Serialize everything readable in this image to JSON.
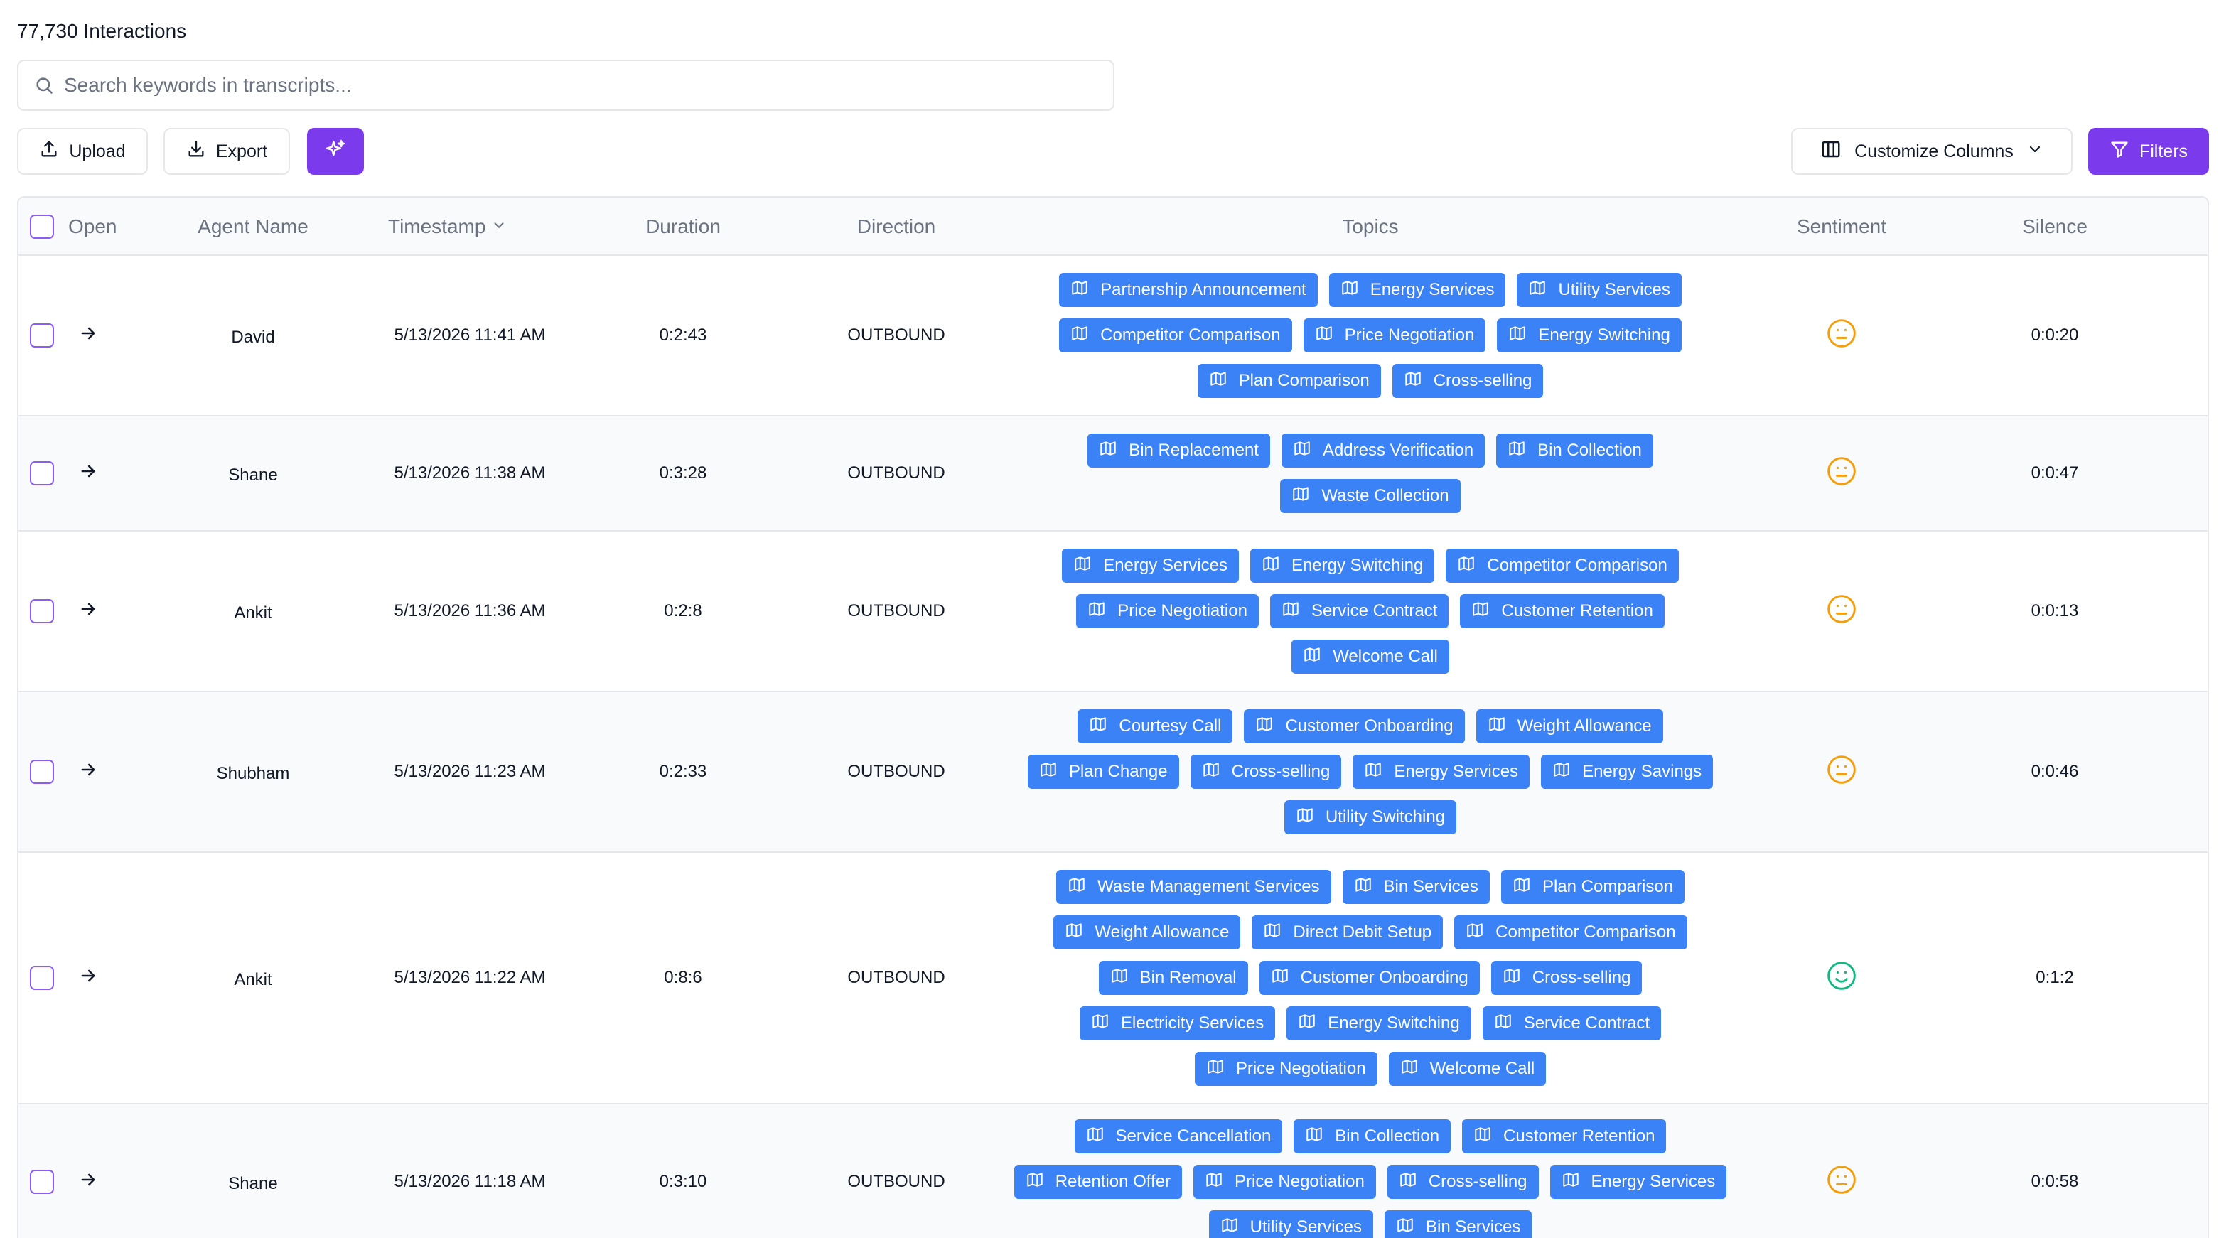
{
  "header": {
    "count_label": "77,730 Interactions"
  },
  "search": {
    "placeholder": "Search keywords in transcripts..."
  },
  "toolbar": {
    "upload_label": "Upload",
    "export_label": "Export",
    "customize_label": "Customize Columns",
    "filters_label": "Filters"
  },
  "colors": {
    "accent": "#7c3aed",
    "tag": "#3b82f6",
    "neutral_sentiment": "#f59e0b",
    "positive_sentiment": "#10b981"
  },
  "table": {
    "columns": {
      "open": "Open",
      "agent": "Agent Name",
      "timestamp": "Timestamp",
      "duration": "Duration",
      "direction": "Direction",
      "topics": "Topics",
      "sentiment": "Sentiment",
      "silence": "Silence"
    },
    "rows": [
      {
        "agent": "David",
        "timestamp": "5/13/2026 11:41 AM",
        "duration": "0:2:43",
        "direction": "OUTBOUND",
        "sentiment": "neutral",
        "silence": "0:0:20",
        "topics": [
          "Partnership Announcement",
          "Energy Services",
          "Utility Services",
          "Competitor Comparison",
          "Price Negotiation",
          "Energy Switching",
          "Plan Comparison",
          "Cross-selling"
        ]
      },
      {
        "agent": "Shane",
        "timestamp": "5/13/2026 11:38 AM",
        "duration": "0:3:28",
        "direction": "OUTBOUND",
        "sentiment": "neutral",
        "silence": "0:0:47",
        "topics": [
          "Bin Replacement",
          "Address Verification",
          "Bin Collection",
          "Waste Collection"
        ]
      },
      {
        "agent": "Ankit",
        "timestamp": "5/13/2026 11:36 AM",
        "duration": "0:2:8",
        "direction": "OUTBOUND",
        "sentiment": "neutral",
        "silence": "0:0:13",
        "topics": [
          "Energy Services",
          "Energy Switching",
          "Competitor Comparison",
          "Price Negotiation",
          "Service Contract",
          "Customer Retention",
          "Welcome Call"
        ]
      },
      {
        "agent": "Shubham",
        "timestamp": "5/13/2026 11:23 AM",
        "duration": "0:2:33",
        "direction": "OUTBOUND",
        "sentiment": "neutral",
        "silence": "0:0:46",
        "topics": [
          "Courtesy Call",
          "Customer Onboarding",
          "Weight Allowance",
          "Plan Change",
          "Cross-selling",
          "Energy Services",
          "Energy Savings",
          "Utility Switching"
        ]
      },
      {
        "agent": "Ankit",
        "timestamp": "5/13/2026 11:22 AM",
        "duration": "0:8:6",
        "direction": "OUTBOUND",
        "sentiment": "positive",
        "silence": "0:1:2",
        "topics": [
          "Waste Management Services",
          "Bin Services",
          "Plan Comparison",
          "Weight Allowance",
          "Direct Debit Setup",
          "Competitor Comparison",
          "Bin Removal",
          "Customer Onboarding",
          "Cross-selling",
          "Electricity Services",
          "Energy Switching",
          "Service Contract",
          "Price Negotiation",
          "Welcome Call"
        ]
      },
      {
        "agent": "Shane",
        "timestamp": "5/13/2026 11:18 AM",
        "duration": "0:3:10",
        "direction": "OUTBOUND",
        "sentiment": "neutral",
        "silence": "0:0:58",
        "topics": [
          "Service Cancellation",
          "Bin Collection",
          "Customer Retention",
          "Retention Offer",
          "Price Negotiation",
          "Cross-selling",
          "Energy Services",
          "Utility Services",
          "Bin Services"
        ]
      }
    ]
  }
}
